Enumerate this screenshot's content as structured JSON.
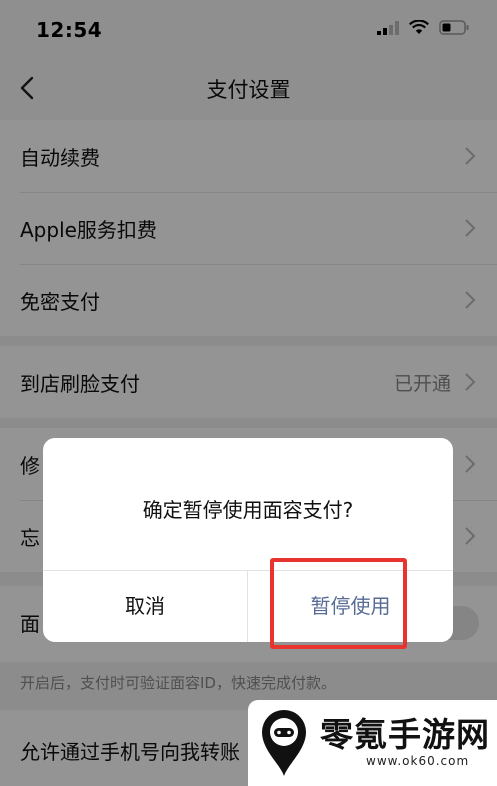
{
  "status_bar": {
    "time": "12:54"
  },
  "nav": {
    "title": "支付设置"
  },
  "group1": [
    {
      "label": "自动续费"
    },
    {
      "label": "Apple服务扣费"
    },
    {
      "label": "免密支付"
    }
  ],
  "group2": {
    "label": "到店刷脸支付",
    "value": "已开通"
  },
  "group3": [
    {
      "label": "修"
    },
    {
      "label": "忘"
    }
  ],
  "face_row": {
    "label": "面"
  },
  "hint": "开启后，支付时可验证面容ID，快速完成付款。",
  "bottom_row": {
    "label": "允许通过手机号向我转账"
  },
  "dialog": {
    "message": "确定暂停使用面容支付?",
    "cancel": "取消",
    "confirm": "暂停使用"
  },
  "watermark": {
    "name": "零氪手游网",
    "url": "www.ok60.com"
  },
  "colors": {
    "accent": "#576b95",
    "highlight": "#e8342e"
  }
}
